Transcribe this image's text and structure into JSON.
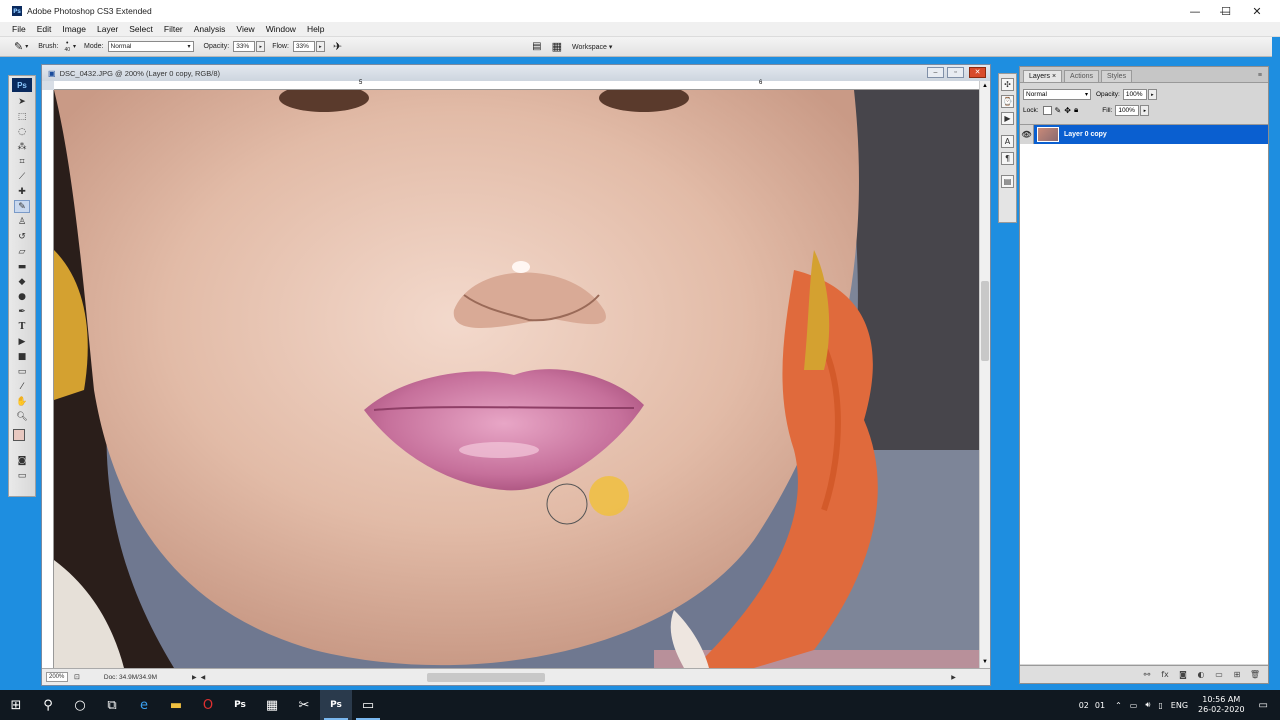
{
  "app": {
    "title": "Adobe Photoshop CS3 Extended",
    "icon": "ps-logo-icon"
  },
  "window_controls": {
    "minimize": "—",
    "maximize": "☐",
    "close": "✕"
  },
  "menu": [
    "File",
    "Edit",
    "Image",
    "Layer",
    "Select",
    "Filter",
    "Analysis",
    "View",
    "Window",
    "Help"
  ],
  "options": {
    "brush_label": "Brush:",
    "brush_size": "40",
    "mode_label": "Mode:",
    "mode_value": "Normal",
    "opacity_label": "Opacity:",
    "opacity_value": "33%",
    "flow_label": "Flow:",
    "flow_value": "33%",
    "workspace_label": "Workspace ▾"
  },
  "document": {
    "title": "DSC_0432.JPG @ 200% (Layer 0 copy, RGB/8)",
    "zoom": "200%",
    "doc_size": "Doc: 34.9M/34.9M",
    "ruler_marks": [
      "5",
      "6"
    ]
  },
  "layers_panel": {
    "tabs": [
      "Layers ×",
      "Actions",
      "Styles"
    ],
    "blend_mode": "Normal",
    "opacity_label": "Opacity:",
    "opacity_value": "100%",
    "lock_label": "Lock:",
    "fill_label": "Fill:",
    "fill_value": "100%",
    "layers": [
      {
        "name": "Layer 0 copy",
        "selected": true,
        "visible": true
      }
    ]
  },
  "taskbar": {
    "icons": [
      "windows-start-icon",
      "search-icon",
      "cortana-icon",
      "task-view-icon",
      "edge-icon",
      "file-explorer-icon",
      "opera-icon",
      "photoshop-icon",
      "calculator-icon",
      "snipping-icon",
      "photoshop-active-icon",
      "app-window-icon"
    ],
    "tray_counts": [
      "02",
      "01"
    ],
    "language": "ENG",
    "time": "10:56 AM",
    "date": "26-02-2020"
  },
  "colors": {
    "accent": "#0a5fd0",
    "desktop": "#1e8ee0",
    "taskbar": "#101820"
  }
}
